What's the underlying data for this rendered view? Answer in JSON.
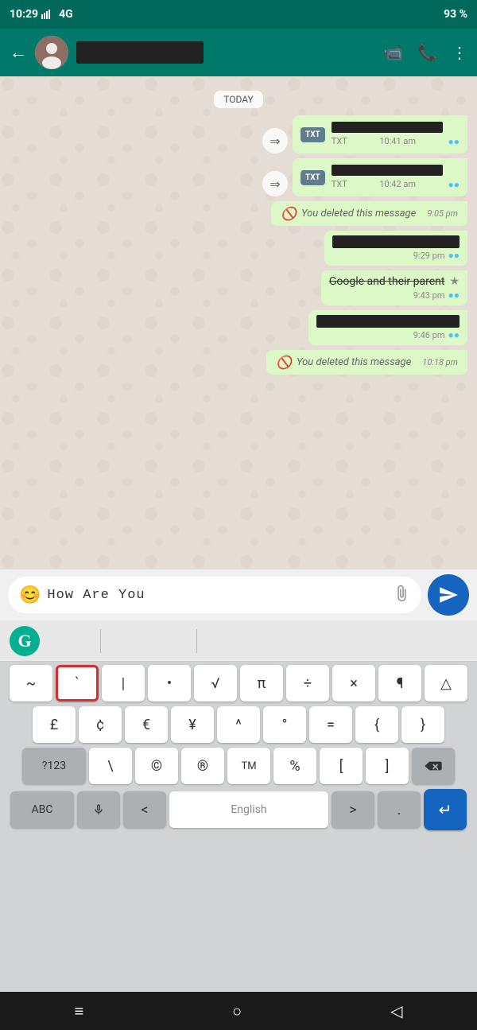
{
  "status_bar": {
    "time": "10:29",
    "signal": "4G",
    "battery": "93 %"
  },
  "header": {
    "back_label": "←",
    "contact_name": "",
    "video_icon": "📹",
    "call_icon": "📞",
    "menu_icon": "⋮"
  },
  "chat": {
    "date_label": "TODAY",
    "messages": [
      {
        "id": 1,
        "type": "file",
        "direction": "sent",
        "file_type": "TXT",
        "time": "10:41 am",
        "forwarded": true
      },
      {
        "id": 2,
        "type": "file",
        "direction": "sent",
        "file_type": "TXT",
        "time": "10:42 am",
        "forwarded": true
      },
      {
        "id": 3,
        "type": "deleted",
        "direction": "sent",
        "text": "You deleted this message",
        "time": "9:05 pm"
      },
      {
        "id": 4,
        "type": "text_redacted",
        "direction": "sent",
        "time": "9:29 pm"
      },
      {
        "id": 5,
        "type": "text_strikethrough",
        "direction": "sent",
        "text": "Google and their parent",
        "time": "9:43 pm"
      },
      {
        "id": 6,
        "type": "text_redacted",
        "direction": "sent",
        "time": "9:46 pm"
      },
      {
        "id": 7,
        "type": "deleted",
        "direction": "sent",
        "text": "You deleted this message",
        "time": "10:18 pm"
      }
    ]
  },
  "input": {
    "text": "How  Are  You",
    "emoji_icon": "😊",
    "attach_icon": "📎",
    "send_icon": "send"
  },
  "keyboard": {
    "grammarly_letter": "G",
    "rows": [
      [
        "~",
        "`",
        "|",
        "•",
        "√",
        "π",
        "÷",
        "×",
        "¶",
        "△"
      ],
      [
        "£",
        "¢",
        "€",
        "¥",
        "^",
        "°",
        "=",
        "{",
        "}"
      ],
      [
        "?123",
        "\\",
        "©",
        "®",
        "™",
        "%",
        "[",
        "]",
        "⌫"
      ]
    ],
    "bottom_row": {
      "abc_label": "ABC",
      "mic_icon": "🎤",
      "less_than": "<",
      "space_label": "English",
      "greater_than": ">",
      "period": ".",
      "enter_icon": "↵"
    }
  },
  "bottom_nav": {
    "home_icon": "≡",
    "circle_icon": "○",
    "back_icon": "◁"
  }
}
